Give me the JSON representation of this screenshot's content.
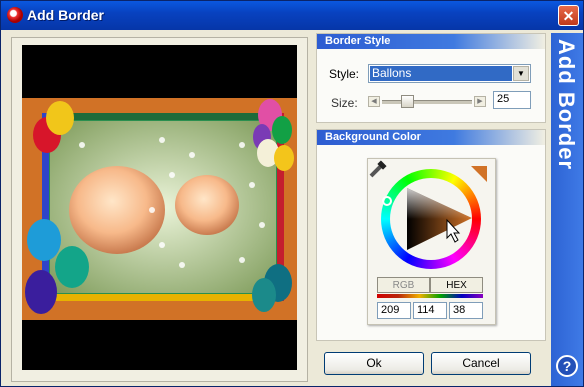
{
  "window": {
    "title": "Add Border",
    "close_glyph": "✕"
  },
  "border_style": {
    "heading": "Border Style",
    "style_label": "Style:",
    "style_value": "Ballons",
    "size_label": "Size:",
    "size_value": "25",
    "size_fraction": 0.25
  },
  "background_color": {
    "heading": "Background Color",
    "mode_rgb": "RGB",
    "mode_hex": "HEX",
    "r": "209",
    "g": "114",
    "b": "38",
    "current_color": "#d17226"
  },
  "buttons": {
    "ok": "Ok",
    "cancel": "Cancel"
  },
  "sidebar": {
    "title": "Add Border",
    "help_glyph": "?"
  },
  "icons": [
    "app-icon",
    "close-icon",
    "eyedropper-icon",
    "chevron-down-icon",
    "help-icon"
  ]
}
